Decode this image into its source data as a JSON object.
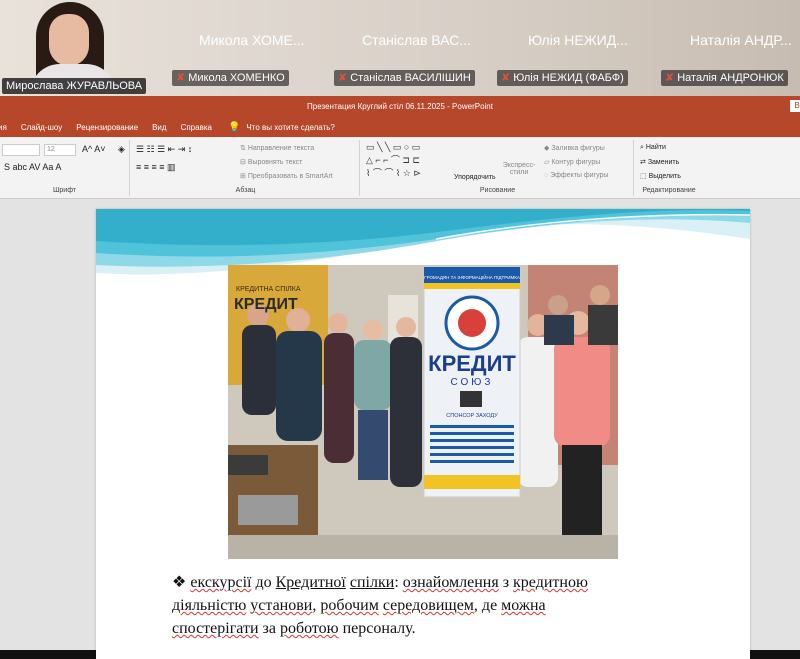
{
  "conference": {
    "self": {
      "name": "Мирослава ЖУРАВЛЬОВА"
    },
    "participants": [
      {
        "short": "Микола ХОМЕ...",
        "full": "Микола ХОМЕНКО"
      },
      {
        "short": "Станіслав ВАС...",
        "full": "Станіслав ВАСИЛІШИН"
      },
      {
        "short": "Юлія НЕЖИД...",
        "full": "Юлія НЕЖИД (ФАБФ)"
      },
      {
        "short": "Наталія АНДР...",
        "full": "Наталія АНДРОНЮК"
      }
    ]
  },
  "window": {
    "title": "Презентация Круглий стіл 06.11.2025  -  PowerPoint",
    "button": "В",
    "menu": [
      "ия",
      "Слайд-шоу",
      "Рецензирование",
      "Вид",
      "Справка"
    ],
    "tell_me": "Что вы хотите сделать?"
  },
  "ribbon": {
    "font_group": "Шрифт",
    "font_size": "12",
    "paragraph_group": "Абзац",
    "paragraph_items": [
      "Направление текста",
      "Выровнять текст",
      "Преобразовать в SmartArt"
    ],
    "drawing_group": "Рисование",
    "arrange_label": "Упорядочить",
    "styles_label": "Экспресс-стили",
    "drawing_items": [
      "Заливка фигуры",
      "Контур фигуры",
      "Эффекты фигуры"
    ],
    "editing_group": "Редактирование",
    "editing_items": [
      "Найти",
      "Заменить",
      "Выделить"
    ]
  },
  "slide": {
    "photo_banner": {
      "top": "ГРОМАДЯН ТА ІНФОРМАЦІЙНА ПІДТРИМКА",
      "brand": "КРЕДИТ",
      "brand2": "СОЮЗ",
      "sponsor": "СПОНСОР ЗАХОДУ"
    },
    "photo_left_sign": {
      "line1": "КРЕДИТНА СПІЛКА",
      "brand": "КРЕДИТ"
    },
    "caption": {
      "bullet": "❖",
      "w1": "екскурсії",
      "w2": " до ",
      "w3": "Кредитної",
      "w4": " ",
      "w5": "спілки",
      "w6": ": ",
      "w7": "ознайомлення",
      "w8": " з  ",
      "w9": "кредитною",
      "w10": "діяльністю",
      "w11": " ",
      "w12": "установи",
      "w13": ", ",
      "w14": "робочим",
      "w15": " ",
      "w16": "середовищем",
      "w17": ",  де ",
      "w18": "можна",
      "w19": "спостерігати",
      "w20": " за ",
      "w21": "роботою",
      "w22": " персоналу."
    }
  },
  "colors": {
    "ppt_accent": "#b7472a",
    "self_border": "#2ecc71",
    "muted_mic": "#e74c3c",
    "wave_cyan": "#4fc3d9"
  }
}
